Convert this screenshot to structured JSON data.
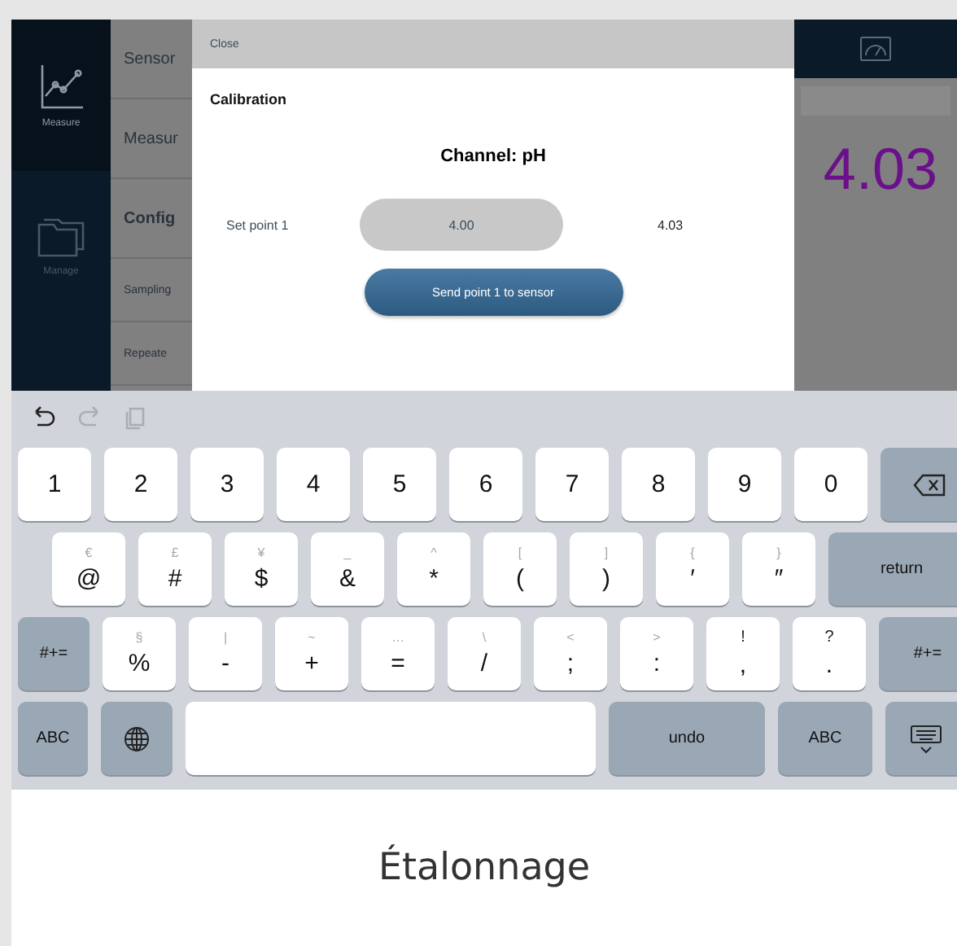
{
  "nav": [
    {
      "label": "Measure",
      "kind": "chart",
      "selected": true
    },
    {
      "label": "Manage",
      "kind": "folder",
      "selected": false
    }
  ],
  "list": [
    {
      "label": "Sensor",
      "kind": "item"
    },
    {
      "label": "Measur",
      "kind": "item"
    },
    {
      "label": "Config",
      "kind": "header"
    },
    {
      "label": "Sampling",
      "kind": "sub"
    },
    {
      "label": "Repeate",
      "kind": "sub"
    }
  ],
  "reading": {
    "value": "4.03"
  },
  "dialog": {
    "close": "Close",
    "title": "Calibration",
    "channel": "Channel: pH",
    "setpoint": {
      "label": "Set point 1",
      "value": "4.00",
      "reading": "4.03"
    },
    "send_button": "Send point 1 to sensor"
  },
  "keyboard": {
    "toolbar": [
      {
        "kind": "undo",
        "disabled": false
      },
      {
        "kind": "redo",
        "disabled": true
      },
      {
        "kind": "paste",
        "disabled": true
      }
    ],
    "number_row": [
      {
        "kind": "char",
        "label": "1"
      },
      {
        "kind": "char",
        "label": "2"
      },
      {
        "kind": "char",
        "label": "3"
      },
      {
        "kind": "char",
        "label": "4"
      },
      {
        "kind": "char",
        "label": "5"
      },
      {
        "kind": "char",
        "label": "6"
      },
      {
        "kind": "char",
        "label": "7"
      },
      {
        "kind": "char",
        "label": "8"
      },
      {
        "kind": "char",
        "label": "9"
      },
      {
        "kind": "char",
        "label": "0"
      },
      {
        "kind": "backspace"
      }
    ],
    "symbol_row": [
      {
        "kind": "char",
        "label": "@",
        "alt": "€"
      },
      {
        "kind": "char",
        "label": "#",
        "alt": "£"
      },
      {
        "kind": "char",
        "label": "$",
        "alt": "¥"
      },
      {
        "kind": "char",
        "label": "&",
        "alt": "_"
      },
      {
        "kind": "char",
        "label": "*",
        "alt": "^"
      },
      {
        "kind": "char",
        "label": "(",
        "alt": "["
      },
      {
        "kind": "char",
        "label": ")",
        "alt": "]"
      },
      {
        "kind": "char",
        "label": "′",
        "alt": "{"
      },
      {
        "kind": "char",
        "label": "″",
        "alt": "}"
      },
      {
        "kind": "action",
        "label": "return"
      }
    ],
    "punctuation_row": [
      {
        "kind": "action",
        "label": "#+="
      },
      {
        "kind": "char",
        "label": "%",
        "alt": "§"
      },
      {
        "kind": "char",
        "label": "-",
        "alt": "|"
      },
      {
        "kind": "char",
        "label": "+",
        "alt": "~"
      },
      {
        "kind": "char",
        "label": "=",
        "alt": "…"
      },
      {
        "kind": "char",
        "label": "/",
        "alt": "\\"
      },
      {
        "kind": "char",
        "label": ";",
        "alt": "<"
      },
      {
        "kind": "char",
        "label": ":",
        "alt": ">"
      },
      {
        "kind": "dual",
        "label": ",",
        "alt": "!"
      },
      {
        "kind": "dual",
        "label": ".",
        "alt": "?"
      },
      {
        "kind": "action",
        "label": "#+="
      }
    ],
    "bottom_row": [
      {
        "kind": "action",
        "label": "ABC"
      },
      {
        "kind": "globe"
      },
      {
        "kind": "space"
      },
      {
        "kind": "action",
        "label": "undo"
      },
      {
        "kind": "action",
        "label": "ABC"
      },
      {
        "kind": "hide"
      }
    ]
  },
  "caption": "Étalonnage"
}
